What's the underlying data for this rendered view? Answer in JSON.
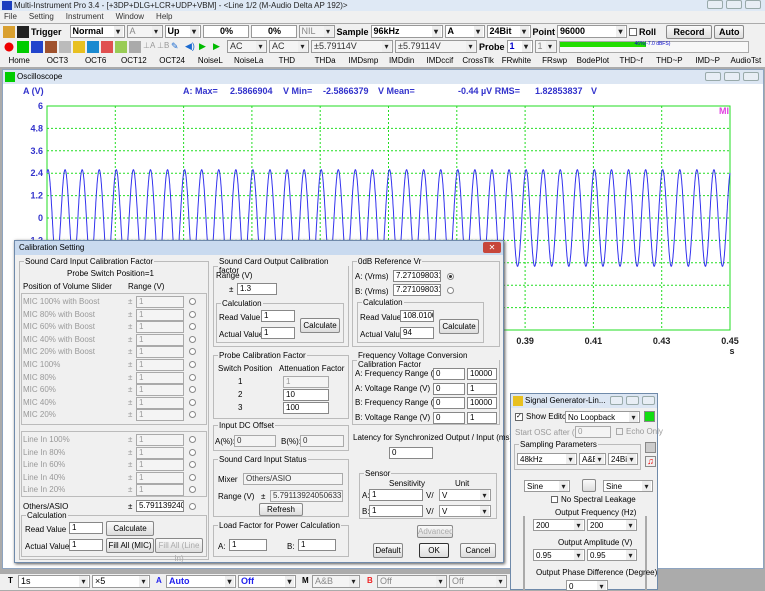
{
  "app": {
    "title": "Multi-Instrument Pro 3.4   -   [+3DP+DLG+LCR+UDP+VBM]   -   <Line 1/2 (M-Audio Delta AP 192)>"
  },
  "menu": [
    "File",
    "Setting",
    "Instrument",
    "Window",
    "Help"
  ],
  "toolbar1": {
    "trigger_label": "Trigger",
    "mode": "Normal",
    "channel": "A",
    "edge": "Up",
    "pct1": "0%",
    "pct2": "0%",
    "nil": "NIL",
    "sample_label": "Sample",
    "sample_rate": "96kHz",
    "sample_channel": "A",
    "bits": "24Bit",
    "point_label": "Point",
    "points": "96000",
    "roll_label": "Roll",
    "record_label": "Record",
    "auto_label": "Auto"
  },
  "toolbar2": {
    "coupling_a": "AC",
    "coupling_b": "AC",
    "range_a": "±5.79114V",
    "range_b": "±5.79114V",
    "probe_label": "Probe",
    "probe_a": "1",
    "probe_b": "1",
    "level_text": "46%(-7.0 dBFS)",
    "level_fraction": 0.46,
    "level_color": "#22dd00"
  },
  "tabs": [
    "Home",
    "OCT3",
    "OCT6",
    "OCT12",
    "OCT24",
    "NoiseL",
    "NoiseLa",
    "THD",
    "THDa",
    "IMDsmp",
    "IMDdin",
    "IMDccif",
    "CrossTlk",
    "FRwhite",
    "FRswp",
    "BodePlot",
    "THD~f",
    "THD~P",
    "IMD~P",
    "AudioTst"
  ],
  "oscilloscope": {
    "title": "Oscilloscope",
    "ylabel": "A (V)",
    "stats": {
      "prefix": "A: Max=",
      "max": "2.5866904",
      "max_unit": "V  Min=",
      "min": "-2.5866379",
      "min_unit": "V  Mean=",
      "mean": "-0.44",
      "mean_unit": "µV  RMS=",
      "rms": "1.82853837",
      "rms_unit": "V"
    },
    "marker": "MI",
    "xunit": "s"
  },
  "chart_data": {
    "type": "line",
    "ylabel": "A (V)",
    "xlabel": "s",
    "ylim": [
      -6,
      6
    ],
    "xlim": [
      0.25,
      0.45
    ],
    "y_ticks_visible": [
      "6",
      "4.8",
      "3.6",
      "2.4",
      "1.2",
      "0",
      "-1.2"
    ],
    "x_ticks_visible": [
      "0.39",
      "0.41",
      "0.43",
      "0.45"
    ],
    "grid": true,
    "series": [
      {
        "waveform": "sine",
        "amplitude": 2.5866904,
        "frequency_hz": 200,
        "color": "#3333ee"
      }
    ],
    "grid_color": "#22dd22"
  },
  "calibration": {
    "title": "Calibration Setting",
    "input_group": "Sound Card Input Calibration Factor",
    "probe_switch": "Probe Switch Position=1",
    "col_position": "Position of Volume Slider",
    "col_range": "Range (V)",
    "mic_rows": [
      {
        "label": "MIC 100% with Boost",
        "value": "1"
      },
      {
        "label": "MIC 80% with Boost",
        "value": "1"
      },
      {
        "label": "MIC 60% with Boost",
        "value": "1"
      },
      {
        "label": "MIC 40% with Boost",
        "value": "1"
      },
      {
        "label": "MIC 20% with Boost",
        "value": "1"
      },
      {
        "label": "MIC 100%",
        "value": "1"
      },
      {
        "label": "MIC 80%",
        "value": "1"
      },
      {
        "label": "MIC 60%",
        "value": "1"
      },
      {
        "label": "MIC 40%",
        "value": "1"
      },
      {
        "label": "MIC 20%",
        "value": "1"
      }
    ],
    "line_rows": [
      {
        "label": "Line In 100%",
        "value": "1"
      },
      {
        "label": "Line In 80%",
        "value": "1"
      },
      {
        "label": "Line In 60%",
        "value": "1"
      },
      {
        "label": "Line In 40%",
        "value": "1"
      },
      {
        "label": "Line In 20%",
        "value": "1"
      }
    ],
    "others_label": "Others/ASIO",
    "others_value": "5.79113924050",
    "pm": "±",
    "in_calc": {
      "legend": "Calculation",
      "read_label": "Read Value",
      "read": "1",
      "actual_label": "Actual Value",
      "actual": "1",
      "calculate": "Calculate",
      "fill_mic": "Fill All (MIC)",
      "fill_line": "Fill All (Line In)"
    },
    "output_group": "Sound Card Output Calibration factor",
    "output_range_label": "Range (V)",
    "output_range": "1.3",
    "out_calc": {
      "legend": "Calculation",
      "read_label": "Read Value",
      "read": "1",
      "actual_label": "Actual Value",
      "actual": "1",
      "calculate": "Calculate"
    },
    "odb": {
      "legend": "0dB Reference Vr",
      "a_label": "A: (Vrms)",
      "a": "7.27109803159",
      "b_label": "B: (Vrms)",
      "b": "7.27109803159",
      "calc_legend": "Calculation",
      "read_label": "Read Value",
      "read": "108.01008",
      "actual_label": "Actual Value",
      "actual": "94",
      "calculate": "Calculate"
    },
    "probe": {
      "legend": "Probe Calibration Factor",
      "col1": "Switch Position",
      "col2": "Attenuation Factor",
      "rows": [
        {
          "pos": "1",
          "factor": "1"
        },
        {
          "pos": "2",
          "factor": "10"
        },
        {
          "pos": "3",
          "factor": "100"
        }
      ]
    },
    "fv": {
      "legend": "Frequency Voltage Conversion Calibration Factor",
      "rows": [
        {
          "label": "A: Frequency Range (Hz)",
          "lo": "0",
          "hi": "10000"
        },
        {
          "label": "A: Voltage Range (V)",
          "lo": "0",
          "hi": "1"
        },
        {
          "label": "B: Frequency Range (Hz)",
          "lo": "0",
          "hi": "10000"
        },
        {
          "label": "B: Voltage Range (V)",
          "lo": "0",
          "hi": "1"
        }
      ]
    },
    "dc": {
      "legend": "Input DC Offset",
      "a_label": "A(%):",
      "a": "0",
      "b_label": "B(%):",
      "b": "0"
    },
    "latency": {
      "label": "Latency for Synchronized Output / Input (ms)",
      "value": "0"
    },
    "status": {
      "legend": "Sound Card Input Status",
      "mixer_label": "Mixer",
      "mixer": "Others/ASIO",
      "range_label": "Range (V)",
      "range": "5.79113924050633",
      "refresh": "Refresh"
    },
    "sensor": {
      "legend": "Sensor",
      "col1": "Sensitivity",
      "col2": "Unit",
      "a_label": "A:",
      "a": "1",
      "a_unit": "V",
      "b_label": "B:",
      "b": "1",
      "b_unit": "V",
      "per": "V/"
    },
    "load": {
      "legend": "Load Factor for Power Calculation",
      "a_label": "A:",
      "a": "1",
      "b_label": "B:",
      "b": "1"
    },
    "advanced": "Advanced",
    "default": "Default",
    "ok": "OK",
    "cancel": "Cancel"
  },
  "siggen": {
    "title": "Signal Generator-Lin...",
    "show_editor": "Show Editor",
    "loopback": "No Loopback",
    "start_osc": "Start OSC after (s)",
    "start_osc_value": "0",
    "echo_only": "Echo Only",
    "sampling_legend": "Sampling Parameters",
    "rate": "48kHz",
    "channels": "A&B",
    "bits": "24Bit",
    "wave_a": "Sine",
    "wave_b": "Sine",
    "no_leakage": "No Spectral Leakage",
    "freq_label": "Output Frequency (Hz)",
    "freq_a": "200",
    "freq_b": "200",
    "amp_label": "Output Amplitude (V)",
    "amp_a": "0.95",
    "amp_b": "0.95",
    "phase_label": "Output Phase Difference (Degree)",
    "phase": "0"
  },
  "bottombar": {
    "t_label": "T",
    "time": "1s",
    "mult": "×5",
    "a_label": "A",
    "a_mode": "Auto",
    "a_off": "Off",
    "m_label": "M",
    "m_mode": "A&B",
    "b_label": "B",
    "b_mode": "Off",
    "b_off": "Off"
  }
}
